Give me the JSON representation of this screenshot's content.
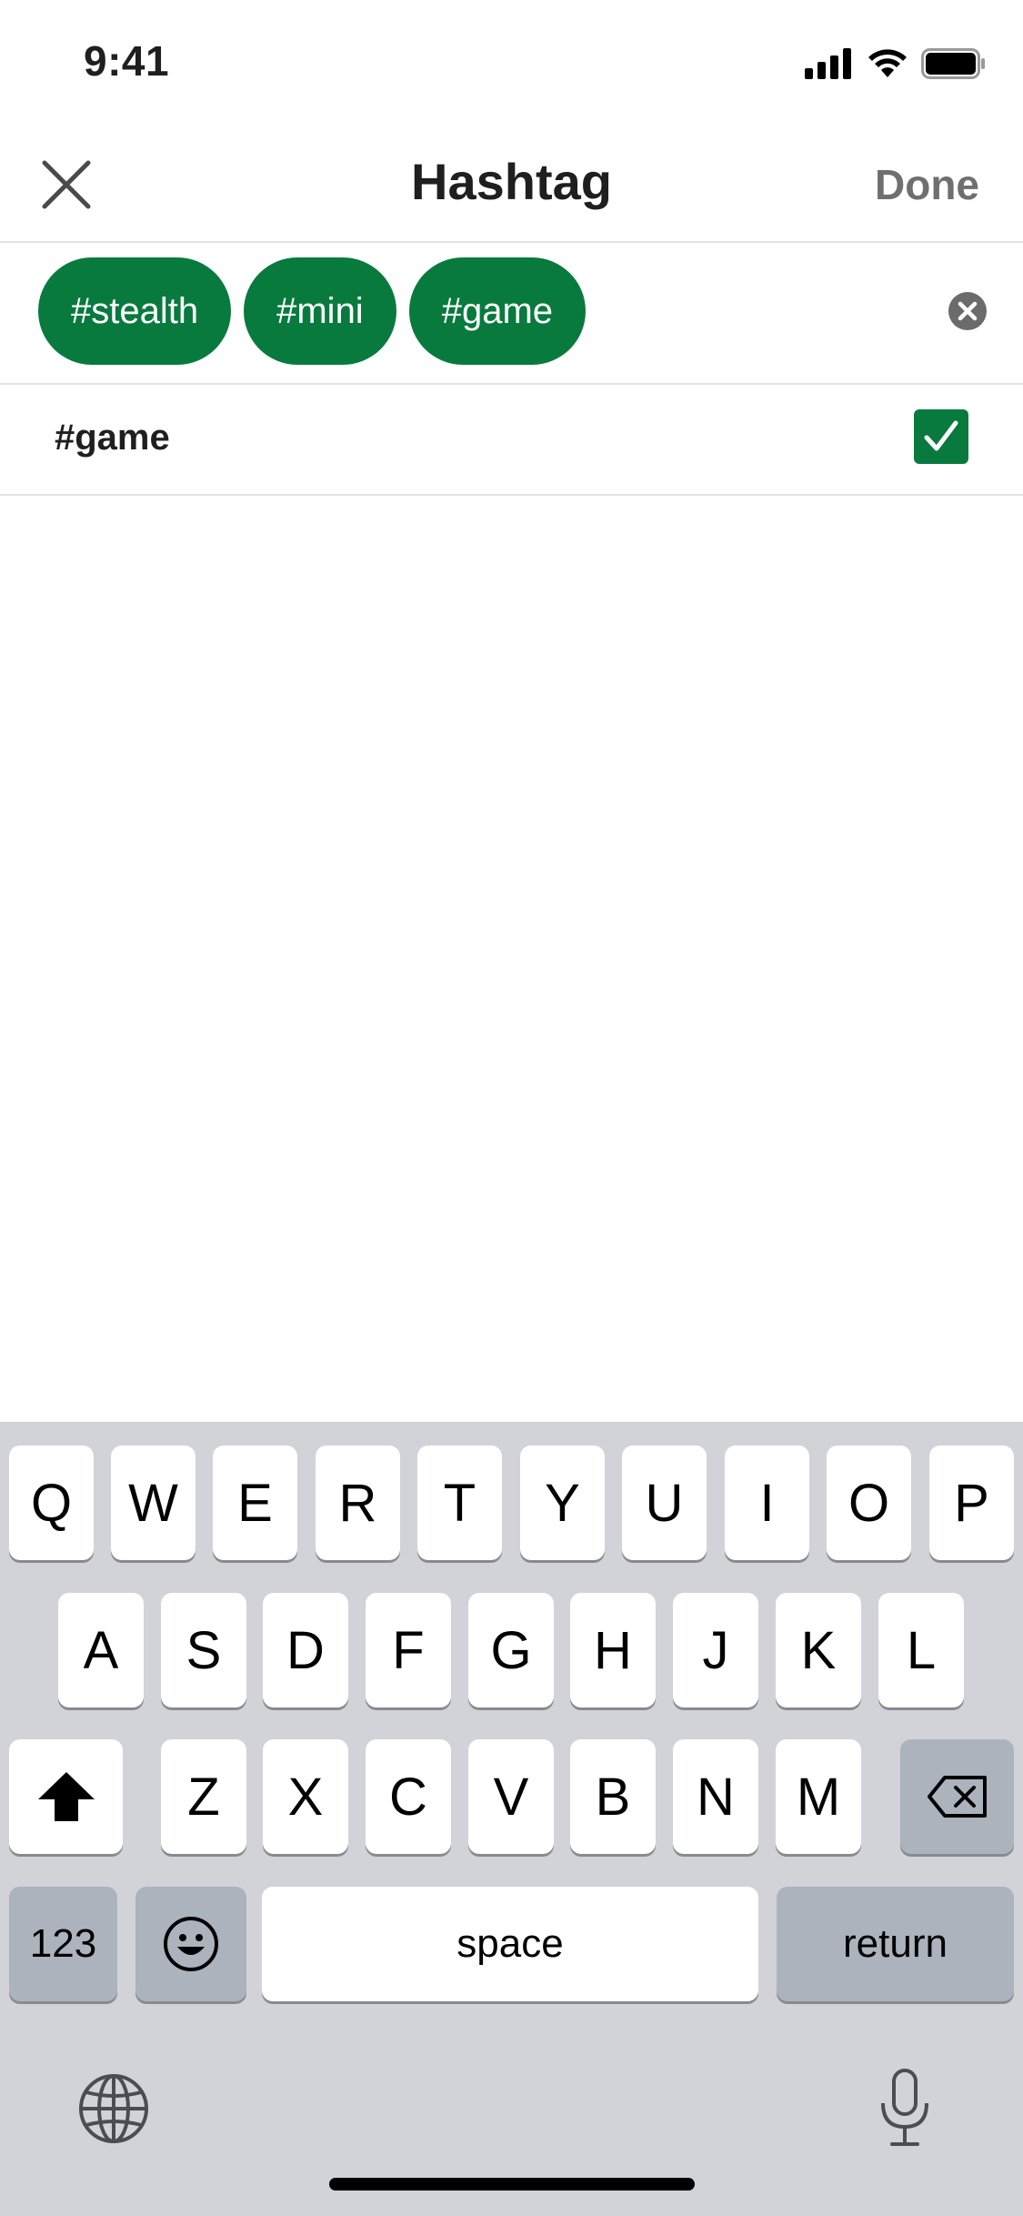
{
  "status_bar": {
    "time": "9:41"
  },
  "header": {
    "title": "Hashtag",
    "done_label": "Done"
  },
  "selected_tags": [
    "#stealth",
    "#mini",
    "#game"
  ],
  "result": {
    "label": "#game",
    "checked": true
  },
  "keyboard": {
    "row1": [
      "Q",
      "W",
      "E",
      "R",
      "T",
      "Y",
      "U",
      "I",
      "O",
      "P"
    ],
    "row2": [
      "A",
      "S",
      "D",
      "F",
      "G",
      "H",
      "J",
      "K",
      "L"
    ],
    "row3": [
      "Z",
      "X",
      "C",
      "V",
      "B",
      "N",
      "M"
    ],
    "numbers_label": "123",
    "space_label": "space",
    "return_label": "return"
  },
  "colors": {
    "accent": "#087a3e",
    "keyboard_bg": "#d1d3d9"
  }
}
